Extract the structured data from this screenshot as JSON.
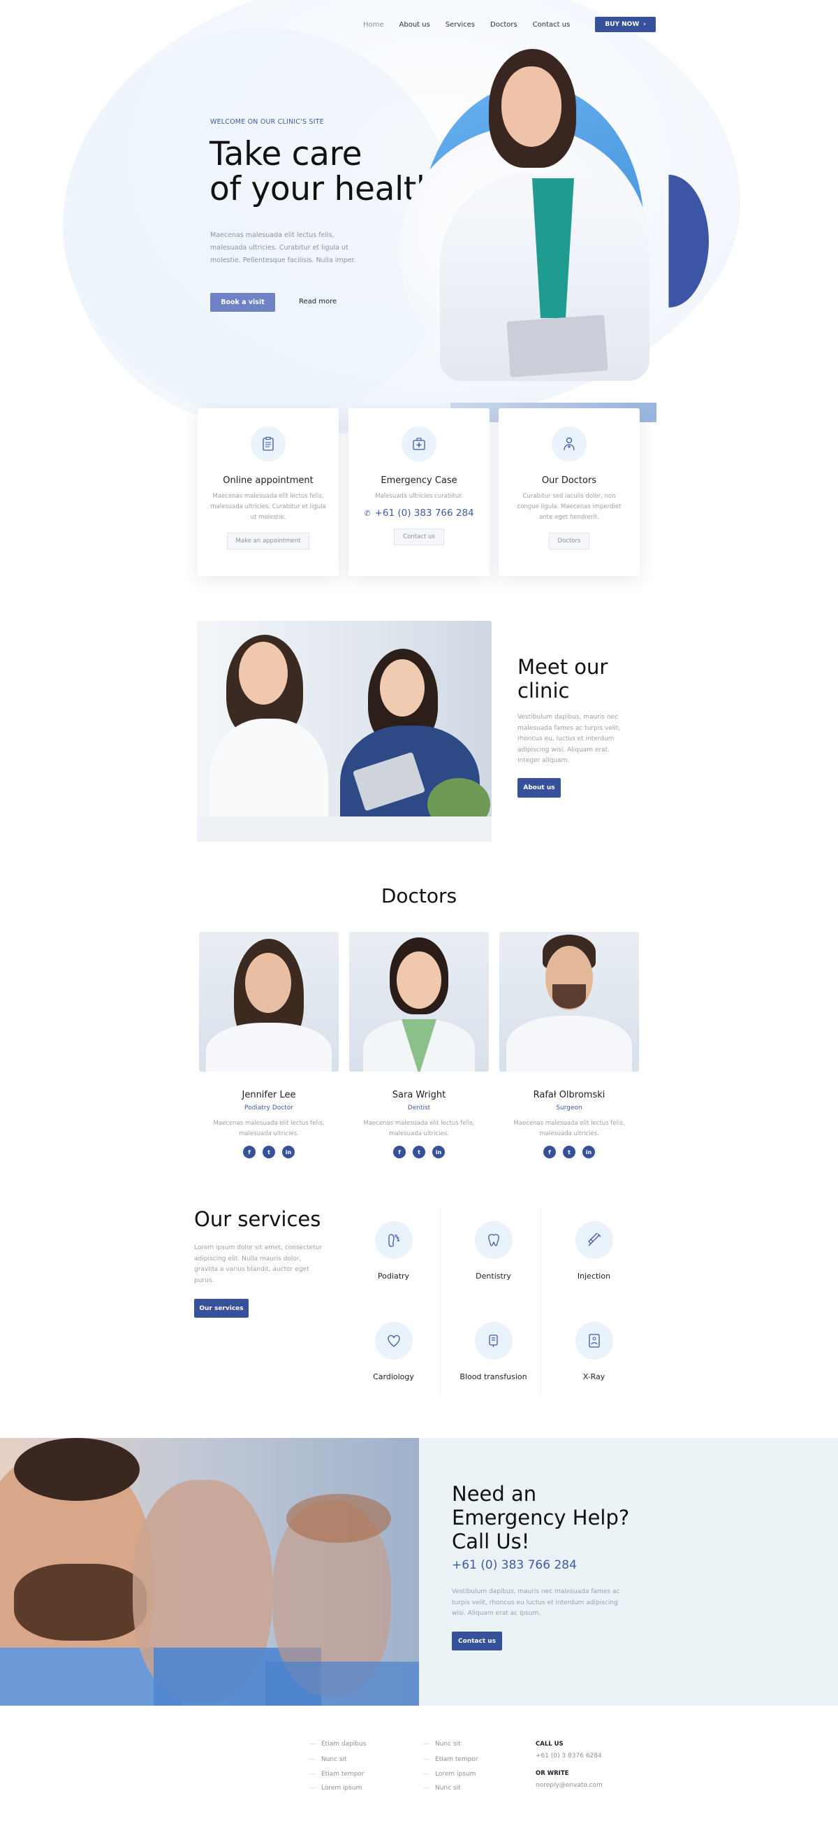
{
  "nav": {
    "items": [
      "Home",
      "About us",
      "Services",
      "Doctors",
      "Contact us"
    ],
    "buy_label": "BUY NOW"
  },
  "hero": {
    "eyebrow": "WELCOME ON OUR CLINIC'S SITE",
    "title_line1": "Take care",
    "title_line2": "of your health",
    "text": "Maecenas malesuada elit lectus felis, malesuada ultricies. Curabitur et ligula ut molestie. Pellentesque facilisis. Nulla imper.",
    "primary_button": "Book a visit",
    "secondary_button": "Read more"
  },
  "features": [
    {
      "title": "Online appointment",
      "text": "Maecenas malesuada elit lectus felis, malesuada ultricies. Curabitur et ligula ut molestie.",
      "button": "Make an appointment",
      "icon": "clipboard-icon"
    },
    {
      "title": "Emergency Case",
      "text": "Malesuada ultricies curabitur.",
      "phone": "+61 (0) 383 766 284",
      "button": "Contact us",
      "icon": "medical-kit-icon"
    },
    {
      "title": "Our Doctors",
      "text": "Curabitur sed iaculis dolor, non congue ligula. Maecenas imperdiet ante eget hendrerit.",
      "button": "Doctors",
      "icon": "doctor-icon"
    }
  ],
  "clinic": {
    "title_line1": "Meet our",
    "title_line2": "clinic",
    "text": "Vestibulum dapibus, mauris nec malesuada fames ac turpis velit, rhoncus eu, luctus et interdum adipiscing wisi. Aliquam erat. Integer aliquam.",
    "button": "About us"
  },
  "doctors": {
    "title": "Doctors",
    "list": [
      {
        "name": "Jennifer Lee",
        "role": "Podiatry Doctor",
        "text": "Maecenas malesuada elit lectus felis, malesuada ultricies."
      },
      {
        "name": "Sara Wright",
        "role": "Dentist",
        "text": "Maecenas malesuada elit lectus felis, malesuada ultricies."
      },
      {
        "name": "Rafał Olbromski",
        "role": "Surgeon",
        "text": "Maecenas malesuada elit lectus felis, malesuada ultricies."
      }
    ],
    "socials": [
      "f",
      "t",
      "in"
    ]
  },
  "services": {
    "title": "Our services",
    "text": "Lorem ipsum dolor sit amet, consectetur adipiscing elit. Nulla mauris dolor, gravida a varius blandit, auctor eget purus.",
    "button": "Our services",
    "items": [
      {
        "label": "Podiatry",
        "icon": "foot-icon"
      },
      {
        "label": "Dentistry",
        "icon": "tooth-icon"
      },
      {
        "label": "Injection",
        "icon": "syringe-icon"
      },
      {
        "label": "Cardiology",
        "icon": "heart-icon"
      },
      {
        "label": "Blood transfusion",
        "icon": "blood-bag-icon"
      },
      {
        "label": "X-Ray",
        "icon": "xray-icon"
      }
    ]
  },
  "emergency": {
    "title_line1": "Need an",
    "title_line2": "Emergency Help?",
    "title_line3": "Call Us!",
    "phone": "+61 (0) 383 766 284",
    "text": "Vestibulum dapibus, mauris nec malesuada fames ac turpis velit, rhoncus eu luctus et interdum adipiscing wisi. Aliquam erat ac ipsum.",
    "button": "Contact us"
  },
  "footer": {
    "col1": [
      "Etiam dapibus",
      "Nunc sit",
      "Etiam tempor",
      "Lorem ipsum"
    ],
    "col2": [
      "Nunc sit",
      "Etiam tempor",
      "Lorem ipsum",
      "Nunc sit"
    ],
    "call_label": "CALL US",
    "call_value": "+61 (0) 3 8376 6284",
    "write_label": "OR WRITE",
    "write_value": "noreply@envato.com"
  },
  "colors": {
    "accent": "#36509a",
    "accent_light": "#6e82c4",
    "link_blue": "#3d5aa7",
    "panel": "#ecf3f7"
  }
}
